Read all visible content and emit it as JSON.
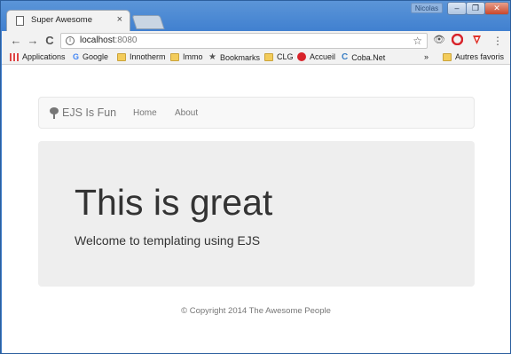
{
  "window": {
    "profile_name": "Nicolas",
    "controls": {
      "minimize": "–",
      "maximize": "❐",
      "close": "✕"
    }
  },
  "tab": {
    "title": "Super Awesome",
    "close": "×"
  },
  "toolbar": {
    "back": "←",
    "forward": "→",
    "reload": "C",
    "url_host": "localhost",
    "url_port": ":8080",
    "info_icon": "i",
    "star_icon": "☆",
    "menu": "⋮"
  },
  "bookmarks": {
    "items": [
      "Applications",
      "Google",
      "Innotherm",
      "Immo",
      "Bookmarks",
      "CLG",
      "Accueil",
      "Coba.Net"
    ],
    "overflow": "»",
    "other": "Autres favoris"
  },
  "page": {
    "brand": "EJS Is Fun",
    "nav": [
      "Home",
      "About"
    ],
    "heading": "This is great",
    "lead": "Welcome to templating using EJS",
    "footer": "© Copyright 2014 The Awesome People"
  },
  "colors": {
    "titlebar": "#3f7fcf",
    "jumbotron": "#eeeeee",
    "navbar": "#f8f8f8",
    "text_muted": "#777777"
  },
  "icons": {
    "tab": "document-icon",
    "brand": "tree-icon",
    "star": "bookmark-star-icon",
    "eye": "eye-icon",
    "opera": "opera-icon",
    "vivaldi": "shield-icon"
  }
}
